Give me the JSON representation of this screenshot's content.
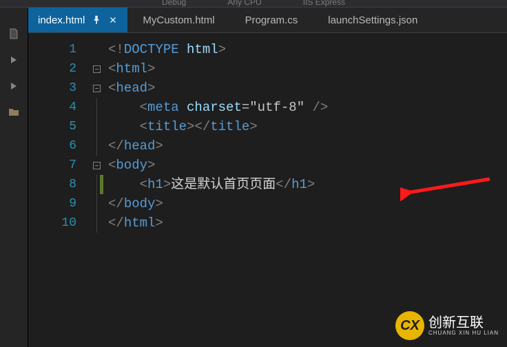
{
  "toolbar": {
    "config": "Debug",
    "platform": "Any CPU",
    "run": "IIS Express"
  },
  "tabs": [
    {
      "label": "index.html",
      "active": true
    },
    {
      "label": "MyCustom.html",
      "active": false
    },
    {
      "label": "Program.cs",
      "active": false
    },
    {
      "label": "launchSettings.json",
      "active": false
    }
  ],
  "gutter": [
    "1",
    "2",
    "3",
    "4",
    "5",
    "6",
    "7",
    "8",
    "9",
    "10"
  ],
  "code": {
    "l1": {
      "a": "<!",
      "b": "DOCTYPE ",
      "c": "html",
      "d": ">"
    },
    "l2": {
      "a": "<",
      "b": "html",
      "c": ">"
    },
    "l3": {
      "a": "<",
      "b": "head",
      "c": ">"
    },
    "l4": {
      "a": "<",
      "b": "meta ",
      "attr": "charset",
      "eq": "=",
      "q1": "\"",
      "val": "utf-8",
      "q2": "\"",
      "end": " />"
    },
    "l5": {
      "a": "<",
      "b": "title",
      "c": ">",
      "d": "</",
      "e": "title",
      "f": ">"
    },
    "l6": {
      "a": "</",
      "b": "head",
      "c": ">"
    },
    "l7": {
      "a": "<",
      "b": "body",
      "c": ">"
    },
    "l8": {
      "a": "<",
      "b": "h1",
      "c": ">",
      "text": "这是默认首页页面",
      "d": "</",
      "e": "h1",
      "f": ">"
    },
    "l9": {
      "a": "</",
      "b": "body",
      "c": ">"
    },
    "l10": {
      "a": "</",
      "b": "html",
      "c": ">"
    }
  },
  "watermark": {
    "badge": "CX",
    "main": "创新互联",
    "sub": "CHUANG XIN HU LIAN"
  },
  "arrow": {
    "icon": "red-arrow-left"
  }
}
